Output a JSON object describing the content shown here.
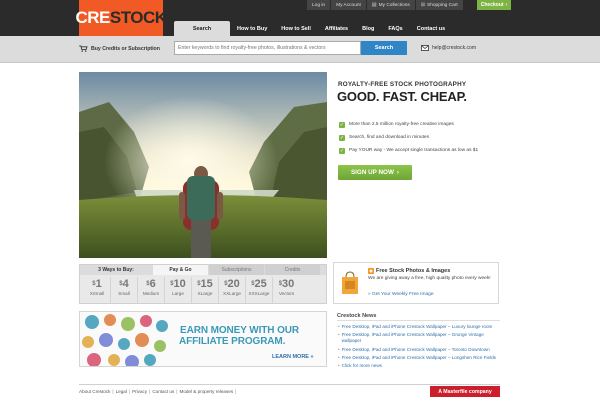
{
  "brand": {
    "logo_part1": "CRE",
    "logo_part2": "STOCK",
    "brand_color": "#f15a24"
  },
  "usernav": {
    "login": "Log in",
    "account": "My Account",
    "collections": "My Collections",
    "cart": "Shopping Cart",
    "checkout": "Checkout",
    "checkout_color": "#7cb342"
  },
  "mainnav": {
    "items": [
      "Search",
      "How to Buy",
      "How to Sell",
      "Affiliates",
      "Blog",
      "FAQs",
      "Contact us"
    ],
    "active": "Search"
  },
  "searchbar": {
    "buy_credits": "Buy Credits or Subscription",
    "placeholder": "Enter keywords to find royalty-free photos, illustrations & vectors",
    "button": "Search",
    "button_color": "#2e86c7",
    "help_email": "help@crestock.com"
  },
  "hero": {
    "eyebrow": "ROYALTY-FREE STOCK PHOTOGRAPHY",
    "headline": "GOOD. FAST. CHEAP.",
    "benefits": [
      "More than 2.5 million royalty-free creative images",
      "Search, find and download in minutes",
      "Pay YOUR way - We accept single transactions as low as $1"
    ],
    "cta": "SIGN UP NOW",
    "cta_color": "#7cb342"
  },
  "pricing": {
    "title": "3 Ways to Buy:",
    "tabs": [
      "Pay & Go",
      "Subscriptions",
      "Credits"
    ],
    "active_tab": "Pay & Go",
    "plans": [
      {
        "amount": "1",
        "size": "XSmall"
      },
      {
        "amount": "4",
        "size": "Small"
      },
      {
        "amount": "6",
        "size": "Medium"
      },
      {
        "amount": "10",
        "size": "Large"
      },
      {
        "amount": "15",
        "size": "XLarge"
      },
      {
        "amount": "20",
        "size": "XXLarge"
      },
      {
        "amount": "25",
        "size": "XXXLarge"
      },
      {
        "amount": "30",
        "size": "Vectors"
      }
    ],
    "currency": "$"
  },
  "free_photos": {
    "title": "Free Stock Photos & Images",
    "description": "We are giving away a free, high quality photo every week!",
    "link": "» Get Your Weekly Free Image"
  },
  "affiliate": {
    "line1": "EARN MONEY WITH OUR",
    "line2": "AFFILIATE PROGRAM.",
    "more": "LEARN MORE »",
    "color": "#3a9ab8"
  },
  "news": {
    "title": "Crestock News",
    "items": [
      "Free Desktop, iPad and iPhone Crestock Wallpaper – Luxury lounge room",
      "Free Desktop, iPad and iPhone Crestock Wallpaper – Grunge Vintage wallpaper",
      "Free Desktop, iPad and iPhone Crestock Wallpaper – Toronto Downtown",
      "Free Desktop, iPad and iPhone Crestock Wallpaper – Longshen Rice Fields",
      "Click for more news"
    ]
  },
  "footer": {
    "links": [
      "About Crestock",
      "Legal",
      "Privacy",
      "Contact us",
      "Model & property releases"
    ],
    "masterfile": "A Masterfile company",
    "masterfile_color": "#cc1f2d"
  }
}
